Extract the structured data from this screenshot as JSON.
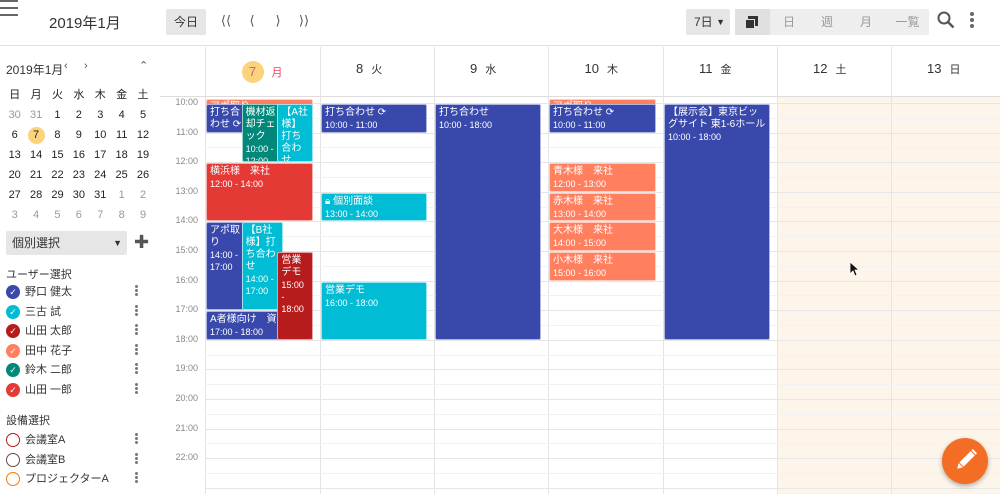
{
  "header": {
    "title": "2019年1月",
    "today_label": "今日",
    "days_select": "7日",
    "views": {
      "day": "日",
      "week": "週",
      "month": "月",
      "list": "一覧"
    }
  },
  "mini_calendar": {
    "title": "2019年1月",
    "weekdays": [
      "日",
      "月",
      "火",
      "水",
      "木",
      "金",
      "土"
    ],
    "weeks": [
      [
        "30",
        "31",
        "1",
        "2",
        "3",
        "4",
        "5"
      ],
      [
        "6",
        "7",
        "8",
        "9",
        "10",
        "11",
        "12"
      ],
      [
        "13",
        "14",
        "15",
        "16",
        "17",
        "18",
        "19"
      ],
      [
        "20",
        "21",
        "22",
        "23",
        "24",
        "25",
        "26"
      ],
      [
        "27",
        "28",
        "29",
        "30",
        "31",
        "1",
        "2"
      ],
      [
        "3",
        "4",
        "5",
        "6",
        "7",
        "8",
        "9"
      ]
    ],
    "today": "7"
  },
  "sidebar": {
    "select_label": "個別選択",
    "users_heading": "ユーザー選択",
    "users": [
      {
        "name": "野口 健太",
        "color": "#3949ab"
      },
      {
        "name": "三古 試",
        "color": "#00bcd4"
      },
      {
        "name": "山田 太郎",
        "color": "#b71c1c"
      },
      {
        "name": "田中 花子",
        "color": "#ff7f5f"
      },
      {
        "name": "鈴木 二郎",
        "color": "#00897b"
      },
      {
        "name": "山田 一郎",
        "color": "#e53935"
      }
    ],
    "facilities_heading": "設備選択",
    "facilities": [
      {
        "name": "会議室A",
        "color": "#b71c1c"
      },
      {
        "name": "会議室B",
        "color": "#6d4c41"
      },
      {
        "name": "プロジェクターA",
        "color": "#f57c00"
      }
    ]
  },
  "days": [
    {
      "num": "7",
      "wd": "月",
      "today": true
    },
    {
      "num": "8",
      "wd": "火"
    },
    {
      "num": "9",
      "wd": "水"
    },
    {
      "num": "10",
      "wd": "木"
    },
    {
      "num": "11",
      "wd": "金"
    },
    {
      "num": "12",
      "wd": "土"
    },
    {
      "num": "13",
      "wd": "日"
    }
  ],
  "hours": [
    "10:00",
    "11:00",
    "12:00",
    "13:00",
    "14:00",
    "15:00",
    "16:00",
    "17:00",
    "18:00",
    "19:00",
    "20:00",
    "21:00",
    "22:00"
  ],
  "events": [
    {
      "day": 0,
      "title": "アポ取り",
      "allday": true,
      "color": "#ff7f5f"
    },
    {
      "day": 0,
      "title": "打ち合わせ",
      "time": "10:00",
      "sh": 10,
      "eh": 11,
      "color": "#3949ab",
      "lane": 0,
      "lanes": 3,
      "sync": true
    },
    {
      "day": 0,
      "title": "機材返却チェック",
      "time": "10:00 - 12:00",
      "sh": 10,
      "eh": 12,
      "color": "#00897b",
      "lane": 1,
      "lanes": 3
    },
    {
      "day": 0,
      "title": "【A社様】打ち合わせ",
      "time": "",
      "sh": 10,
      "eh": 12,
      "color": "#00bcd4",
      "lane": 2,
      "lanes": 3
    },
    {
      "day": 0,
      "title": "横浜様　来社",
      "time": "12:00 - 14:00",
      "sh": 12,
      "eh": 14,
      "color": "#e53935",
      "lane": 0,
      "lanes": 1
    },
    {
      "day": 0,
      "title": "アポ取り",
      "time": "14:00 - 17:00",
      "sh": 14,
      "eh": 17,
      "color": "#3949ab",
      "lane": 0,
      "lanes": 3
    },
    {
      "day": 0,
      "title": "【B社様】打ち合わせ",
      "time": "14:00 - 17:00",
      "sh": 14,
      "eh": 17,
      "color": "#00bcd4",
      "lane": 1,
      "lanes": 3
    },
    {
      "day": 0,
      "title": "営業デモ",
      "time": "15:00 - 18:00",
      "sh": 15,
      "eh": 18,
      "color": "#b71c1c",
      "lane": 2,
      "lanes": 3
    },
    {
      "day": 0,
      "title": "A者様向け　資料確認",
      "time": "17:00 - 18:00",
      "sh": 17,
      "eh": 18,
      "color": "#3949ab",
      "lane": 0,
      "lanes": 1
    },
    {
      "day": 1,
      "title": "打ち合わせ",
      "time": "10:00 - 11:00",
      "sh": 10,
      "eh": 11,
      "color": "#3949ab",
      "lane": 0,
      "lanes": 1,
      "sync": true
    },
    {
      "day": 1,
      "title": "個別面談",
      "time": "13:00 - 14:00",
      "sh": 13,
      "eh": 14,
      "color": "#00bcd4",
      "lane": 0,
      "lanes": 1,
      "lock": true
    },
    {
      "day": 1,
      "title": "営業デモ",
      "time": "16:00 - 18:00",
      "sh": 16,
      "eh": 18,
      "color": "#00bcd4",
      "lane": 0,
      "lanes": 1
    },
    {
      "day": 2,
      "title": "打ち合わせ",
      "time": "10:00 - 18:00",
      "sh": 10,
      "eh": 18,
      "color": "#3949ab",
      "lane": 0,
      "lanes": 1
    },
    {
      "day": 3,
      "title": "アポ取り",
      "allday": true,
      "color": "#ff7f5f"
    },
    {
      "day": 3,
      "title": "打ち合わせ",
      "time": "10:00 - 11:00",
      "sh": 10,
      "eh": 11,
      "color": "#3949ab",
      "lane": 0,
      "lanes": 1,
      "sync": true
    },
    {
      "day": 3,
      "title": "青木様　来社",
      "time": "12:00 - 13:00",
      "sh": 12,
      "eh": 13,
      "color": "#ff7f5f",
      "lane": 0,
      "lanes": 1
    },
    {
      "day": 3,
      "title": "赤木様　来社",
      "time": "13:00 - 14:00",
      "sh": 13,
      "eh": 14,
      "color": "#ff7f5f",
      "lane": 0,
      "lanes": 1
    },
    {
      "day": 3,
      "title": "大木様　来社",
      "time": "14:00 - 15:00",
      "sh": 14,
      "eh": 15,
      "color": "#ff7f5f",
      "lane": 0,
      "lanes": 1
    },
    {
      "day": 3,
      "title": "小木様　来社",
      "time": "15:00 - 16:00",
      "sh": 15,
      "eh": 16,
      "color": "#ff7f5f",
      "lane": 0,
      "lanes": 1
    },
    {
      "day": 4,
      "title": "【展示会】東京ビッグサイト 東1-6ホール",
      "time": "10:00 - 18:00",
      "sh": 10,
      "eh": 18,
      "color": "#3949ab",
      "lane": 0,
      "lanes": 1
    }
  ]
}
